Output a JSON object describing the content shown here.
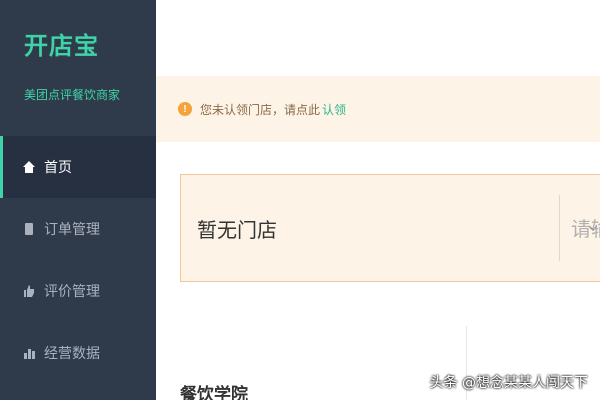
{
  "sidebar": {
    "brand": "开店宝",
    "tagline": "美团点评餐饮商家",
    "items": [
      {
        "label": "首页",
        "icon": "home-icon",
        "active": true
      },
      {
        "label": "订单管理",
        "icon": "order-icon",
        "active": false
      },
      {
        "label": "评价管理",
        "icon": "thumbs-up-icon",
        "active": false
      },
      {
        "label": "经营数据",
        "icon": "data-icon",
        "active": false
      }
    ]
  },
  "notice": {
    "icon": "warning-icon",
    "text": "您未认领门店，请点此",
    "link": "认领"
  },
  "store_selector": {
    "value": "暂无门店",
    "input_placeholder": "请输"
  },
  "section": {
    "title": "餐饮学院"
  },
  "watermark": "头条 @想念某某人闯天下",
  "colors": {
    "sidebar_bg": "#2f3a4a",
    "accent": "#3fd3a8",
    "notice_bg": "#fdf3e6",
    "border": "#f6c59a"
  }
}
